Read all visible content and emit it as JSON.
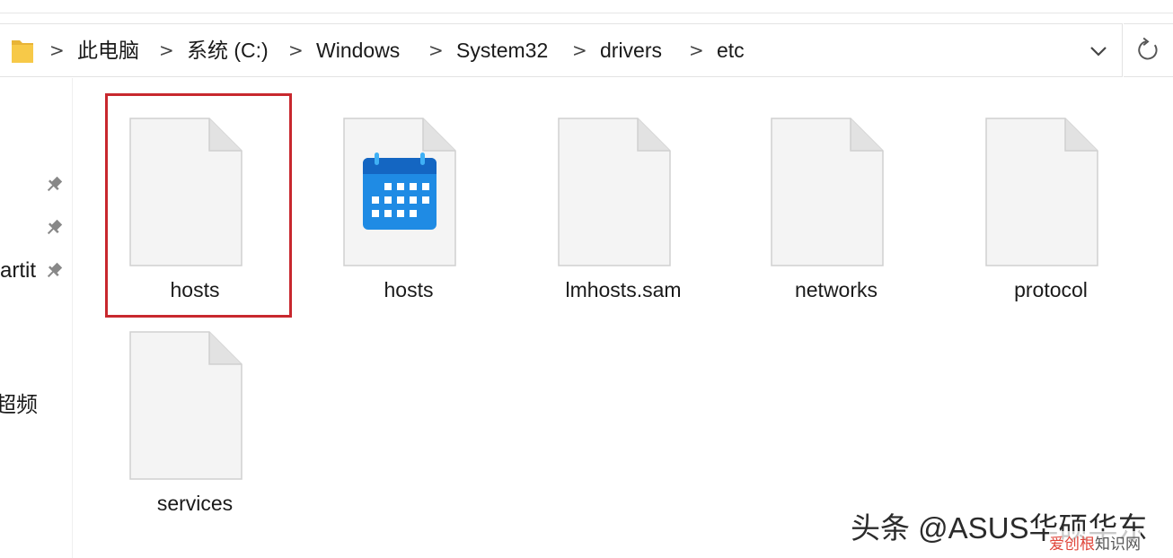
{
  "address_bar": {
    "breadcrumbs": [
      "此电脑",
      "系统 (C:)",
      "Windows",
      "System32",
      "drivers",
      "etc"
    ],
    "separator": ">",
    "folder_icon": "folder-icon",
    "dropdown_icon": "chevron-down-icon",
    "refresh_icon": "refresh-icon"
  },
  "nav_pane": {
    "items": [
      {
        "label": "",
        "icon": "pin-icon"
      },
      {
        "label": "",
        "icon": "pin-icon"
      },
      {
        "label": "artit",
        "icon": "pin-icon"
      },
      {
        "label": "超频",
        "icon": ""
      }
    ]
  },
  "files": [
    {
      "name": "hosts",
      "icon": "blank-document-icon",
      "selected": true
    },
    {
      "name": "hosts",
      "icon": "calendar-document-icon",
      "selected": false
    },
    {
      "name": "lmhosts.sam",
      "icon": "blank-document-icon",
      "selected": false
    },
    {
      "name": "networks",
      "icon": "blank-document-icon",
      "selected": false
    },
    {
      "name": "protocol",
      "icon": "blank-document-icon",
      "selected": false
    },
    {
      "name": "services",
      "icon": "blank-document-icon",
      "selected": false
    }
  ],
  "watermark": {
    "main": "头条 @ASUS华硕华东",
    "sub_red": "爱创根",
    "sub_grey": "知识网"
  },
  "colors": {
    "selection_border": "#c8282e",
    "calendar_blue": "#1a7fd9",
    "folder_yellow": "#f7c948"
  }
}
